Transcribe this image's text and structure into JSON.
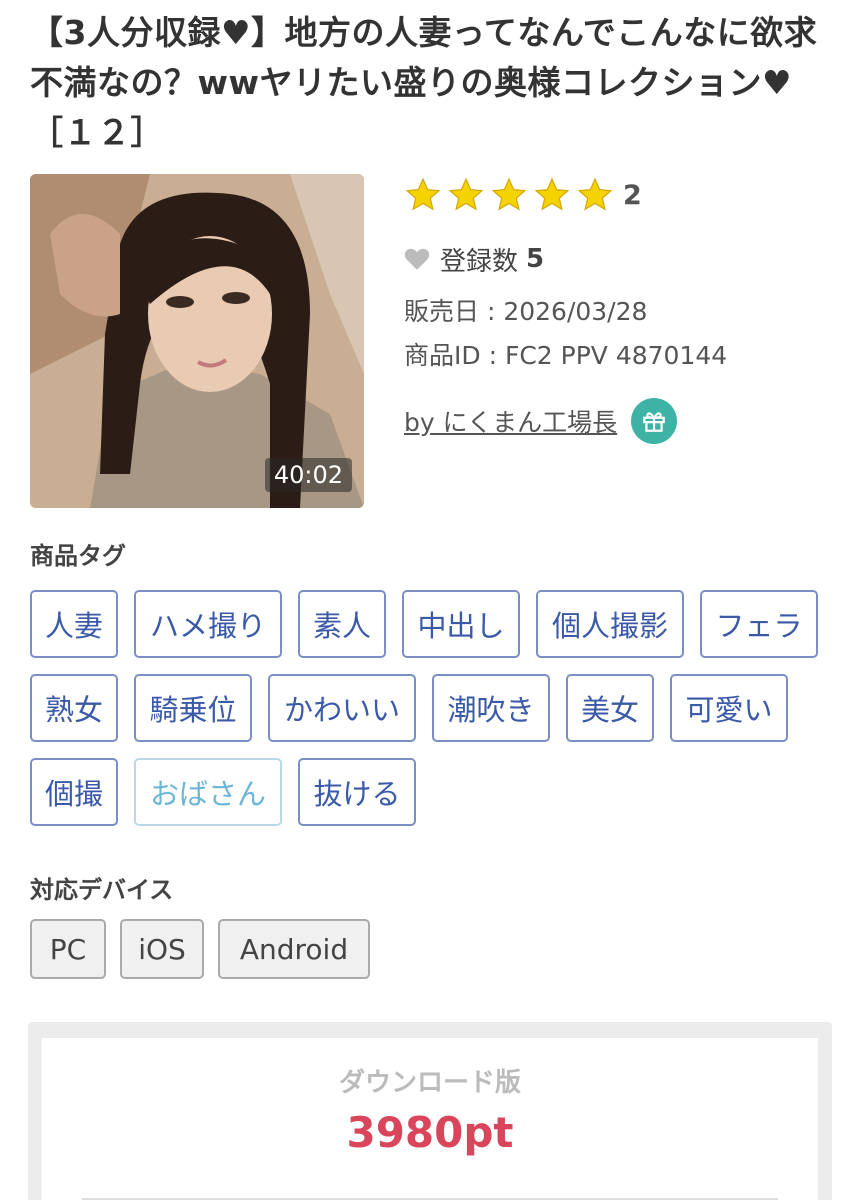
{
  "product": {
    "title": "【3人分収録♥】地方の人妻ってなんでこんなに欲求不満なの？wwヤリたい盛りの奥様コレクション♥［１２］",
    "duration": "40:02",
    "rating_count": "2",
    "favorites_label": "登録数",
    "favorites_count": "5",
    "release_date": "販売日 : 2026/03/28",
    "product_id": "商品ID : FC2 PPV 4870144",
    "seller": "by にくまん工場長"
  },
  "tags_section": {
    "label": "商品タグ",
    "rows": [
      [
        "人妻",
        "ハメ撮り",
        "素人",
        "中出し",
        "個人撮影",
        "フェラ"
      ],
      [
        "熟女",
        "騎乗位",
        "かわいい",
        "潮吹き",
        "美女",
        "可愛い"
      ],
      [
        "個撮",
        "おばさん",
        "抜ける"
      ]
    ]
  },
  "devices_section": {
    "label": "対応デバイス",
    "items": [
      "PC",
      "iOS",
      "Android"
    ]
  },
  "purchase": {
    "version_label": "ダウンロード版",
    "price": "3980pt"
  },
  "colors": {
    "star": "#f5d300",
    "tag_border": "#7b8fc4",
    "tag_text": "#3a5aa8",
    "tag_visited": "#6cb6d6",
    "price": "#d9455a",
    "gift": "#3db3a6"
  },
  "icons": {
    "rating": "star-icon",
    "favorite": "heart-icon",
    "gift": "gift-icon"
  }
}
